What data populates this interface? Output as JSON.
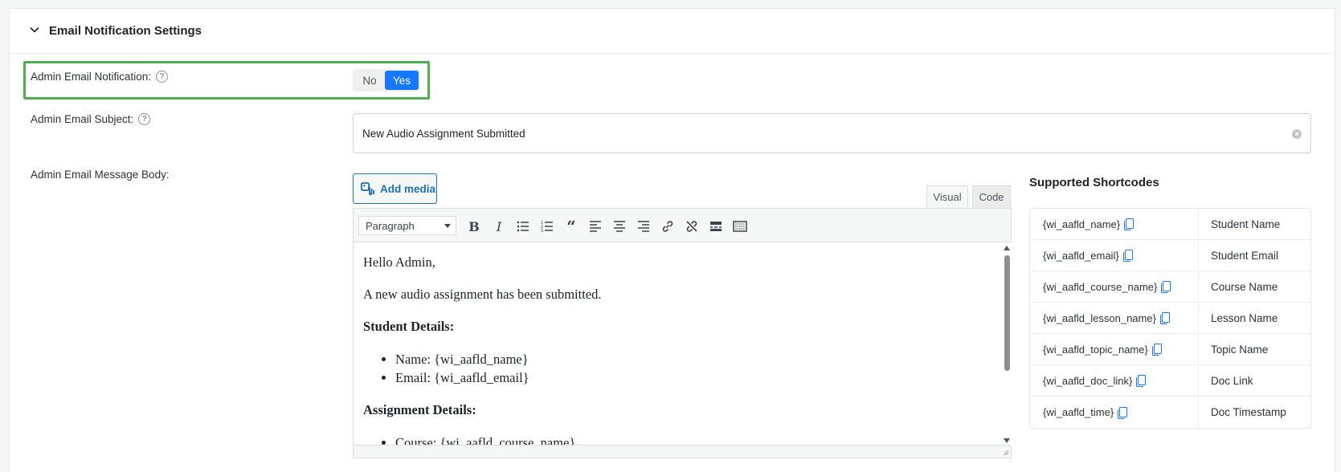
{
  "section": {
    "title": "Email Notification Settings"
  },
  "admin_notification": {
    "label": "Admin Email Notification:",
    "options": [
      "No",
      "Yes"
    ],
    "selected": "Yes"
  },
  "admin_subject": {
    "label": "Admin Email Subject:",
    "value": "New Audio Assignment Submitted"
  },
  "admin_body": {
    "label": "Admin Email Message Body:",
    "add_media_label": "Add media",
    "tabs": [
      "Visual",
      "Code"
    ],
    "active_tab": "Visual",
    "format_select": "Paragraph",
    "content": {
      "greeting": "Hello Admin,",
      "intro": "A new audio assignment has been submitted.",
      "student_heading": "Student Details:",
      "student_items": [
        "Name: {wi_aafld_name}",
        "Email: {wi_aafld_email}"
      ],
      "assignment_heading": "Assignment Details:",
      "assignment_items": [
        "Course: {wi_aafld_course_name}"
      ]
    }
  },
  "shortcodes": {
    "title": "Supported Shortcodes",
    "rows": [
      {
        "code": "{wi_aafld_name}",
        "label": "Student Name"
      },
      {
        "code": "{wi_aafld_email}",
        "label": "Student Email"
      },
      {
        "code": "{wi_aafld_course_name}",
        "label": "Course Name"
      },
      {
        "code": "{wi_aafld_lesson_name}",
        "label": "Lesson Name"
      },
      {
        "code": "{wi_aafld_topic_name}",
        "label": "Topic Name"
      },
      {
        "code": "{wi_aafld_doc_link}",
        "label": "Doc Link"
      },
      {
        "code": "{wi_aafld_time}",
        "label": "Doc Timestamp"
      }
    ]
  },
  "colors": {
    "accent": "#1677ff",
    "highlight": "#4caf50",
    "link": "#2271b1"
  }
}
